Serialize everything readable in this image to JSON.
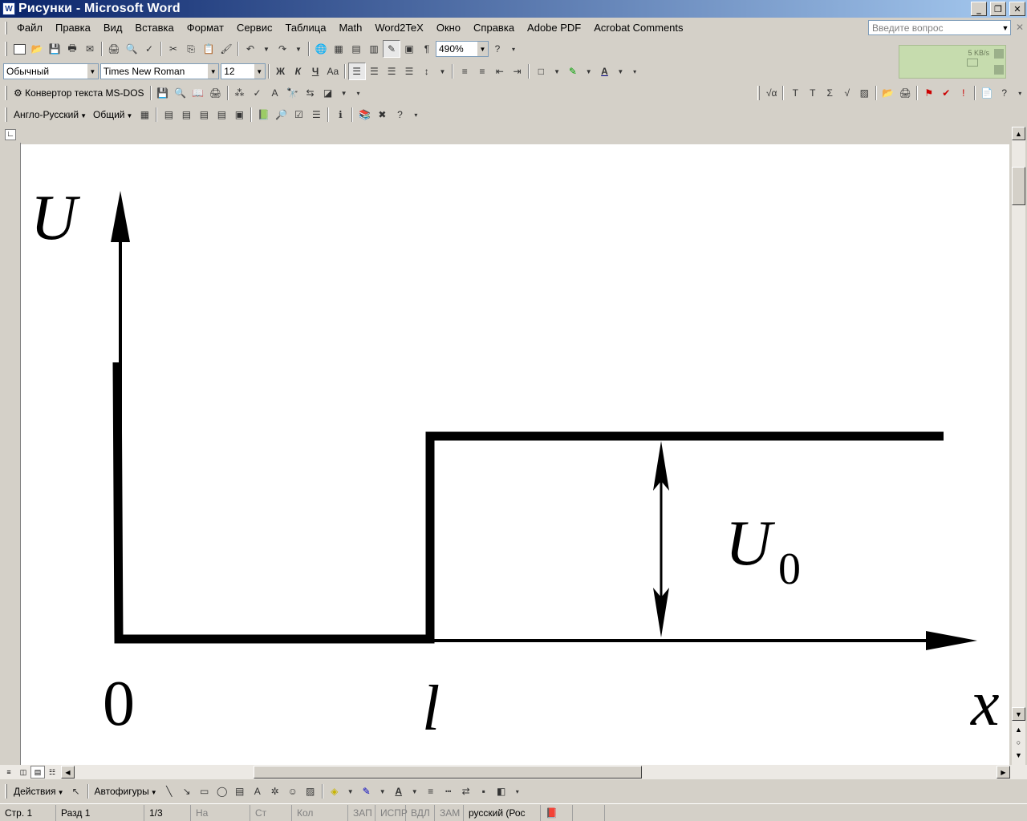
{
  "window": {
    "title": "Рисунки - Microsoft Word",
    "app_icon_label": "W"
  },
  "menubar": {
    "items": [
      "Файл",
      "Правка",
      "Вид",
      "Вставка",
      "Формат",
      "Сервис",
      "Таблица",
      "Math",
      "Word2TeX",
      "Окно",
      "Справка",
      "Adobe PDF",
      "Acrobat Comments"
    ],
    "help_search_placeholder": "Введите вопрос"
  },
  "toolbar_standard": {
    "zoom": "490%"
  },
  "toolbar_formatting": {
    "style": "Обычный",
    "font": "Times New Roman",
    "size": "12",
    "bold": "Ж",
    "italic": "К",
    "underline": "Ч"
  },
  "toolbar_msdos": {
    "converter_label": "Конвертор текста MS-DOS"
  },
  "toolbar_dictionary": {
    "direction": "Англо-Русский",
    "topic": "Общий"
  },
  "network_meter": {
    "rate": "5 KB/s"
  },
  "figure": {
    "y_axis_label": "U",
    "x_axis_label": "x",
    "origin_label": "0",
    "step_label": "l",
    "barrier_label_main": "U",
    "barrier_label_sub": "0"
  },
  "drawing_toolbar": {
    "actions": "Действия",
    "autoshapes": "Автофигуры"
  },
  "statusbar": {
    "page": "Стр. 1",
    "section": "Разд 1",
    "page_of": "1/3",
    "at": "На",
    "line": "Ст",
    "column": "Кол",
    "rec": "ЗАП",
    "trk": "ИСПР",
    "ext": "ВДЛ",
    "ovr": "ЗАМ",
    "language": "русский (Рос"
  },
  "colors": {
    "title_gradient_start": "#0a246a",
    "title_gradient_end": "#a6caf0",
    "chrome": "#d4d0c8"
  }
}
